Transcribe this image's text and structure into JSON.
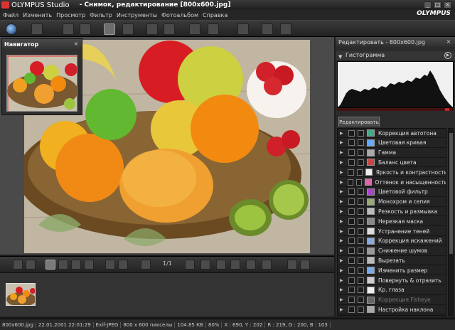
{
  "window": {
    "app_name": "OLYMPUS Studio",
    "document_title": "- Снимок, редактирование [800x600.jpg]",
    "min_label": "_",
    "max_label": "□",
    "close_label": "×"
  },
  "menu": [
    "Файл",
    "Изменить",
    "Просмотр",
    "Фильтр",
    "Инструменты",
    "Фотоальбом",
    "Справка"
  ],
  "brand": "OLYMPUS",
  "navigator": {
    "title": "Навигатор",
    "close": "×"
  },
  "image_toolbar": {
    "page_counter": "1/1"
  },
  "right_panel": {
    "header": "Редактировать - 800x600.jpg",
    "close": "×",
    "histogram_title": "Гистограмма",
    "tab_label": "Редактировать",
    "tools": [
      {
        "label": "Коррекция автотона",
        "color": "#4a8"
      },
      {
        "label": "Цветовая кривая",
        "color": "#6af"
      },
      {
        "label": "Гамма",
        "color": "#aaa"
      },
      {
        "label": "Баланс цвета",
        "color": "#c44"
      },
      {
        "label": "Яркость и контрастность",
        "color": "#eee"
      },
      {
        "label": "Оттенок и насыщенность",
        "color": "#d6a"
      },
      {
        "label": "Цветовой фильтр",
        "color": "#a4c"
      },
      {
        "label": "Монохром и сепия",
        "color": "#9a7"
      },
      {
        "label": "Резкость и размывка",
        "color": "#bbb"
      },
      {
        "label": "Нерезкая маска",
        "color": "#888"
      },
      {
        "label": "Устранение теней",
        "color": "#ddd"
      },
      {
        "label": "Коррекция искажений",
        "color": "#8ad"
      },
      {
        "label": "Снижение шумов",
        "color": "#999"
      },
      {
        "label": "Вырезать",
        "color": "#bbb"
      },
      {
        "label": "Изменить размер",
        "color": "#7ae"
      },
      {
        "label": "Повернуть & отразить",
        "color": "#ccc"
      },
      {
        "label": "Кр. глаза",
        "color": "#eee"
      },
      {
        "label": "Коррекция Fisheye",
        "color": "#666",
        "disabled": true
      },
      {
        "label": "Настройка наклона",
        "color": "#aaa"
      }
    ]
  },
  "status": [
    "800x600.jpg",
    "22.01.2001 22:01:29",
    "Exif-JPEG",
    "800 x 600 пикселы",
    "104.85 КБ",
    "80%",
    "X : 690, Y : 202",
    "R : 219, G : 200, B : 103"
  ]
}
